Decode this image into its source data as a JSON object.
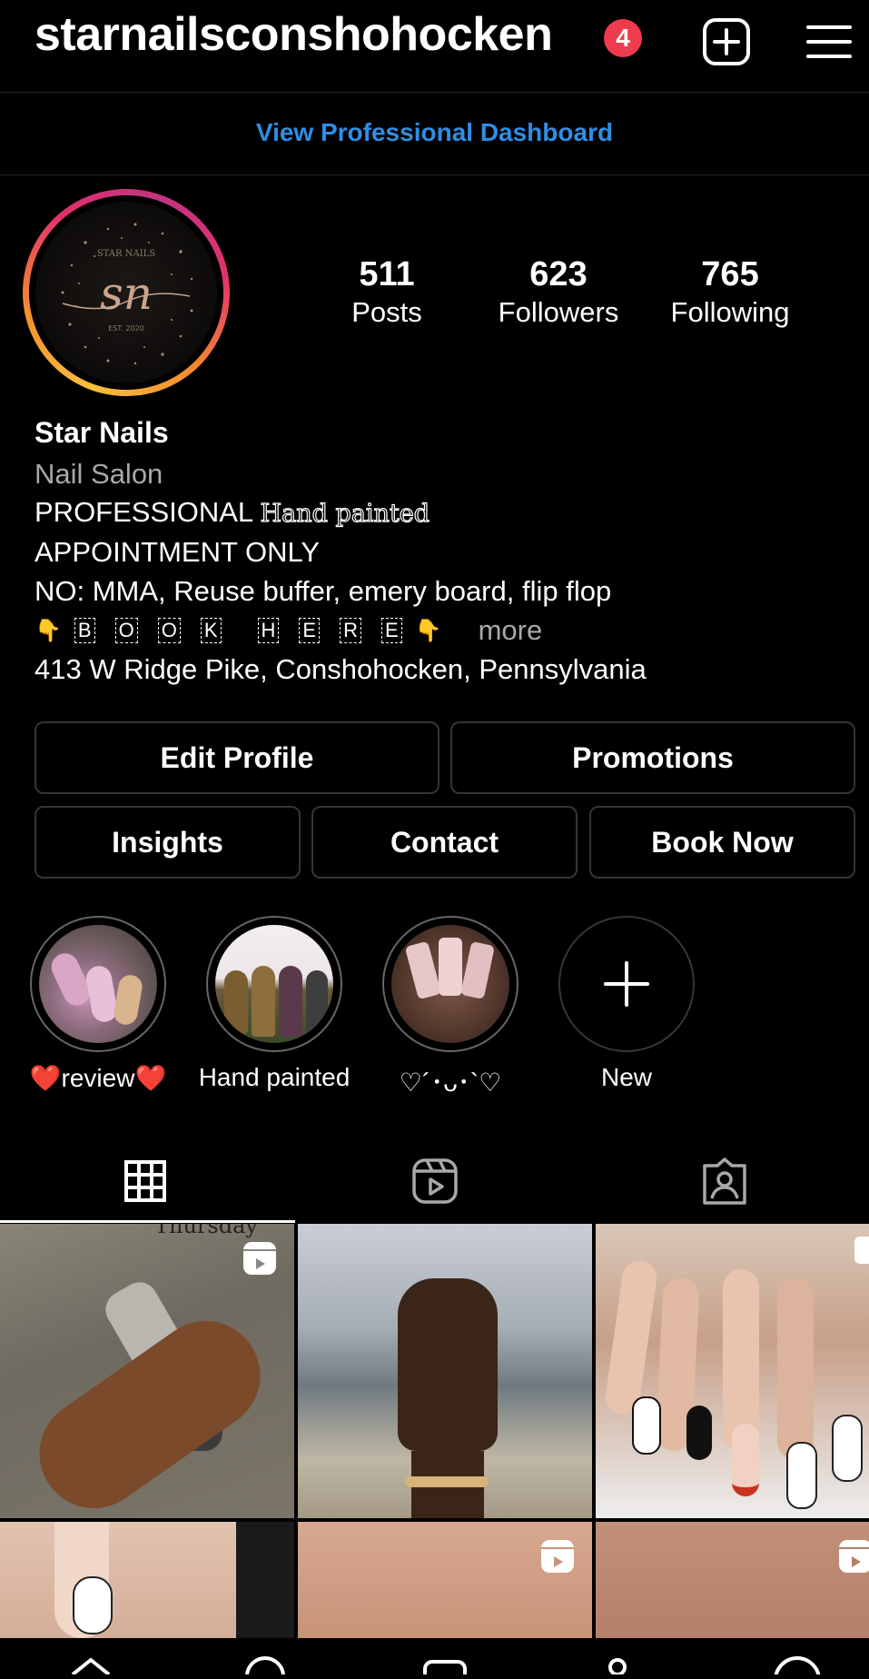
{
  "header": {
    "username": "starnailsconshohocken",
    "notification_count": "4",
    "icons": [
      "plus-square-icon",
      "hamburger-menu-icon"
    ]
  },
  "dashboard_link": "View Professional Dashboard",
  "profile": {
    "avatar_text": "sn",
    "stats": [
      {
        "value": "511",
        "label": "Posts"
      },
      {
        "value": "623",
        "label": "Followers"
      },
      {
        "value": "765",
        "label": "Following"
      }
    ],
    "name": "Star Nails",
    "category": "Nail Salon",
    "bio_line1_prefix": "PROFESSIONAL ",
    "bio_line1_styled": "Hand painted",
    "bio_line2": "APPOINTMENT ONLY",
    "bio_line3": "NO: MMA, Reuse buffer, emery board, flip flop",
    "bio_line4_letters": [
      "B",
      "O",
      "O",
      "K",
      "H",
      "E",
      "R",
      "E"
    ],
    "bio_more": "more",
    "address": "413 W Ridge Pike, Conshohocken, Pennsylvania"
  },
  "buttons": {
    "edit_profile": "Edit Profile",
    "promotions": "Promotions",
    "insights": "Insights",
    "contact": "Contact",
    "book_now": "Book Now"
  },
  "highlights": [
    {
      "label": "❤️review❤️"
    },
    {
      "label": "Hand painted"
    },
    {
      "label": "♡´･ᴗ･`♡"
    },
    {
      "label": "New"
    }
  ],
  "tabs": [
    "grid-icon",
    "reels-icon",
    "tagged-icon"
  ],
  "grid_text": {
    "post1_caption": "Thursday"
  },
  "colors": {
    "link_blue": "#2d8fe6",
    "badge_red": "#ef3b4e",
    "button_border": "#363636"
  }
}
